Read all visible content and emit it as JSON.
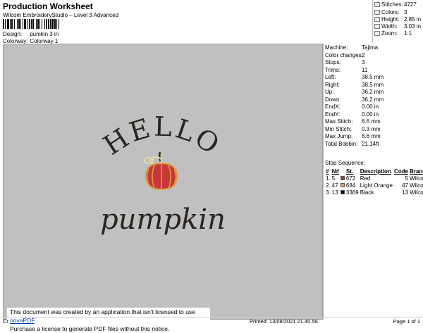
{
  "header": {
    "title": "Production Worksheet",
    "subtitle": "Wilcom EmbroideryStudio – Level 3 Advanced",
    "design_label": "Design:",
    "design_value": "pumkin 3 in",
    "colorway_label": "Colorway:",
    "colorway_value": "Colorway 1"
  },
  "stats": [
    {
      "label": "Stitches:",
      "value": "4727"
    },
    {
      "label": "Colors:",
      "value": "3"
    },
    {
      "label": "Height:",
      "value": "2.85 in"
    },
    {
      "label": "Width:",
      "value": "3.03 in"
    },
    {
      "label": "Zoom:",
      "value": "1:1"
    }
  ],
  "design_text": {
    "line1": "HELLO",
    "line2": "pumpkin"
  },
  "machine_info": [
    {
      "label": "Machine:",
      "value": "Tajima"
    },
    {
      "label": "Color changes:",
      "value": "2"
    },
    {
      "label": "Stops:",
      "value": "3"
    },
    {
      "label": "Trims:",
      "value": "11"
    },
    {
      "label": "Left:",
      "value": "38.5 mm"
    },
    {
      "label": "Right:",
      "value": "38.5 mm"
    },
    {
      "label": "Up:",
      "value": "36.2 mm"
    },
    {
      "label": "Down:",
      "value": "36.2 mm"
    },
    {
      "label": "EndX:",
      "value": "0.00 in"
    },
    {
      "label": "EndY:",
      "value": "0.00 in"
    },
    {
      "label": "Max Stitch:",
      "value": "6.6 mm"
    },
    {
      "label": "Min Stitch:",
      "value": "0.3 mm"
    },
    {
      "label": "Max Jump:",
      "value": "6.6 mm"
    },
    {
      "label": "Total Bobbin:",
      "value": "21.14ft"
    }
  ],
  "stop_sequence": {
    "heading": "Stop Sequence:",
    "columns": [
      "#",
      "N#",
      "",
      "St.",
      "Description",
      "Code",
      "Brand"
    ],
    "rows": [
      {
        "idx": "1.",
        "n": "5",
        "color": "#d42a1e",
        "st": "672",
        "desc": "Red",
        "code": "5",
        "brand": "Wilcom"
      },
      {
        "idx": "2.",
        "n": "47",
        "color": "#e89a5a",
        "st": "684",
        "desc": "Light Orange",
        "code": "47",
        "brand": "Wilcom"
      },
      {
        "idx": "3.",
        "n": "13",
        "color": "#111111",
        "st": "3369",
        "desc": "Black",
        "code": "13",
        "brand": "Wilcom"
      }
    ]
  },
  "notice": {
    "line1_before": "This document was created by an application that isn't licensed to use ",
    "link": "novaPDF",
    "line1_after": ".",
    "line2": "Purchase a license to generate PDF files without this notice."
  },
  "footer": {
    "left": "Cr",
    "printed": "Printed: 13/08/2021 21.40.56",
    "page": "Page 1 of 1"
  }
}
